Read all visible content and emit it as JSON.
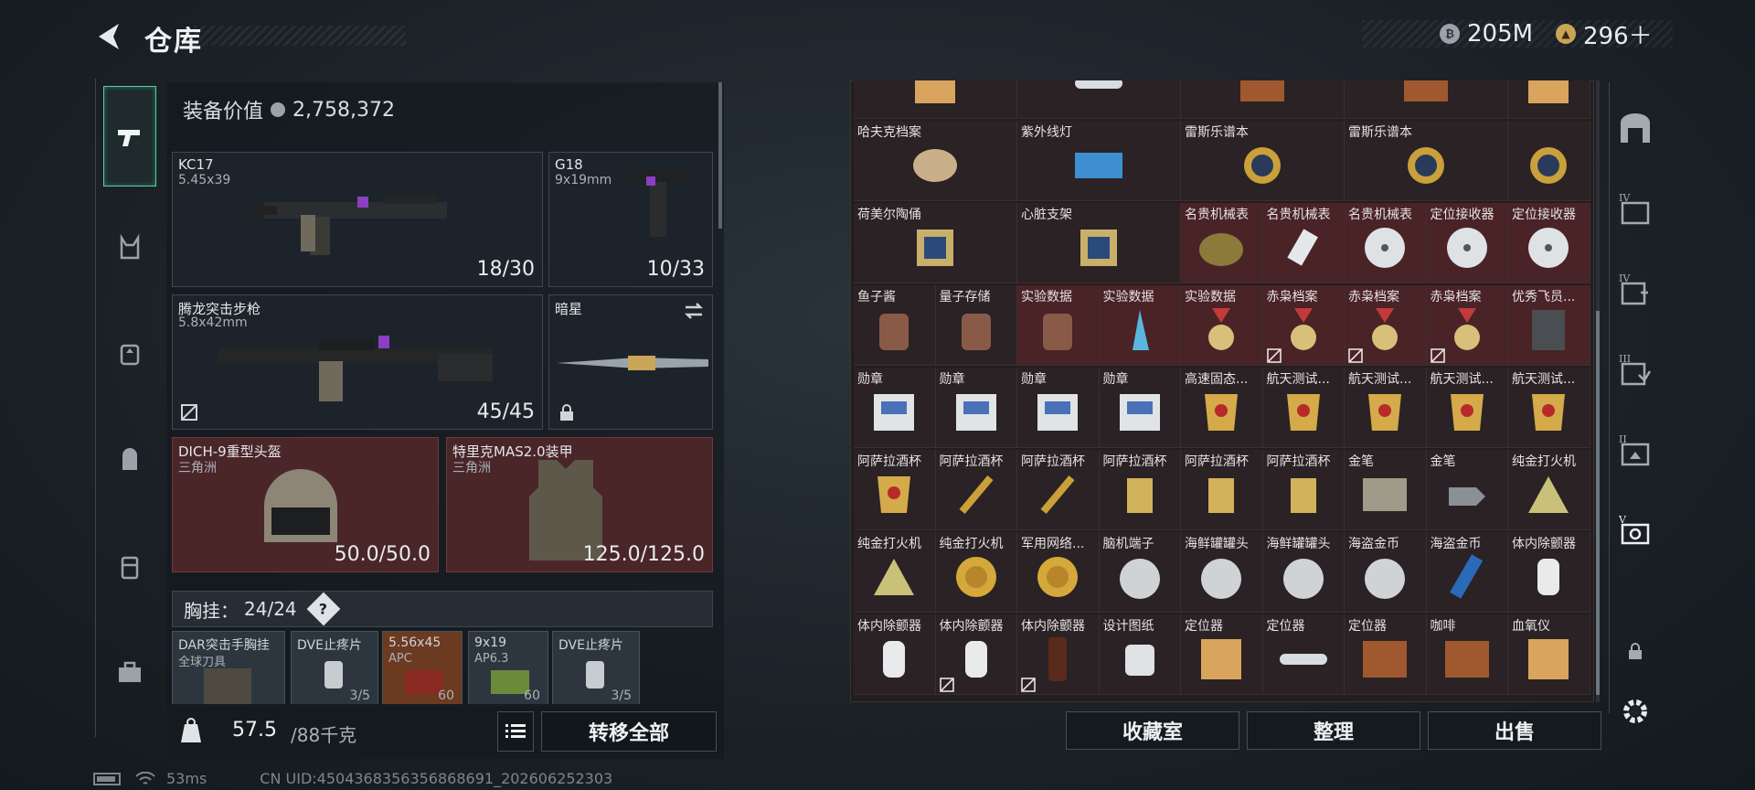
{
  "header": {
    "title": "仓库",
    "currency": [
      {
        "icon": "silver-coin-icon",
        "value": "205M"
      },
      {
        "icon": "gold-coin-icon",
        "value": "296＋"
      }
    ]
  },
  "left_rail": [
    {
      "icon": "pistol-icon",
      "active": true
    },
    {
      "icon": "backpack-frame-icon"
    },
    {
      "icon": "pouch-icon"
    },
    {
      "icon": "backpack-icon"
    },
    {
      "icon": "case-icon"
    },
    {
      "icon": "toolbox-icon"
    }
  ],
  "equipment": {
    "value_label": "装备价值",
    "value": "2,758,372",
    "slots": [
      {
        "name": "KC17",
        "sub": "5.45x39",
        "value": "18/30"
      },
      {
        "name": "G18",
        "sub": "9x19mm",
        "value": "10/33"
      },
      {
        "name": "腾龙突击步枪",
        "sub": "5.8x42mm",
        "value": "45/45"
      },
      {
        "name": "暗星",
        "sub": "",
        "value": ""
      },
      {
        "name": "DICH-9重型头盔",
        "sub": "三角洲",
        "value": "50.0/50.0"
      },
      {
        "name": "特里克MAS2.0装甲",
        "sub": "三角洲",
        "value": "125.0/125.0"
      }
    ],
    "chest_label": "胸挂：",
    "chest_value": "24/24",
    "pouch": [
      {
        "name": "DAR突击手胸挂",
        "sub": "全球刀具",
        "count": ""
      },
      {
        "name": "DVE止疼片",
        "sub": "",
        "count": "3/5"
      },
      {
        "name": "5.56x45",
        "sub": "APC",
        "count": "60"
      },
      {
        "name": "9x19",
        "sub": "AP6.3",
        "count": "60"
      },
      {
        "name": "DVE止疼片",
        "sub": "",
        "count": "3/5"
      }
    ],
    "weight": "57.5",
    "weight_max": "/88千克",
    "transfer_all": "转移全部"
  },
  "stash": {
    "rows": [
      [
        "",
        "",
        "",
        "",
        ""
      ],
      [
        "哈夫克档案",
        "紫外线灯",
        "雷斯乐谱本",
        "雷斯乐谱本",
        ""
      ],
      [
        "荷美尔陶俑",
        "心脏支架",
        "名贵机械表",
        "名贵机械表",
        "名贵机械表",
        "定位接收器",
        "定位接收器"
      ],
      [
        "鱼子酱",
        "量子存储",
        "实验数据",
        "实验数据",
        "实验数据",
        "赤枭档案",
        "赤枭档案",
        "赤枭档案",
        "优秀飞员..."
      ],
      [
        "勋章",
        "勋章",
        "勋章",
        "勋章",
        "高速固态...",
        "航天测试...",
        "航天测试...",
        "航天测试...",
        "航天测试..."
      ],
      [
        "阿萨拉酒杯",
        "阿萨拉酒杯",
        "阿萨拉酒杯",
        "阿萨拉酒杯",
        "阿萨拉酒杯",
        "阿萨拉酒杯",
        "金笔",
        "金笔",
        "纯金打火机"
      ],
      [
        "纯金打火机",
        "纯金打火机",
        "军用网络...",
        "脑机端子",
        "海鲜罐罐头",
        "海鲜罐罐头",
        "海盗金币",
        "海盗金币",
        "体内除颤器"
      ],
      [
        "体内除颤器",
        "体内除颤器",
        "体内除颤器",
        "设计图纸",
        "定位器",
        "定位器",
        "定位器",
        "咖啡",
        "血氧仪"
      ]
    ],
    "buttons": {
      "collection": "收藏室",
      "sort": "整理",
      "sell": "出售"
    }
  },
  "right_rail": [
    {
      "icon": "vault-icon"
    },
    {
      "icon": "folder-iv-icon",
      "label": "IV"
    },
    {
      "icon": "case-iv-icon",
      "label": "IV"
    },
    {
      "icon": "case-iii-icon",
      "label": "III"
    },
    {
      "icon": "case-ii-icon",
      "label": "II"
    },
    {
      "icon": "case-v-icon",
      "label": "V"
    },
    {
      "icon": "lock-icon"
    },
    {
      "icon": "gear-icon"
    }
  ],
  "status": {
    "ping": "53ms",
    "uid": "CN UID:4504368356356868691_202606252303"
  },
  "colors": {
    "accent": "#4fd39a",
    "red_slot": "#4a2629",
    "panel": "#231d1e"
  }
}
